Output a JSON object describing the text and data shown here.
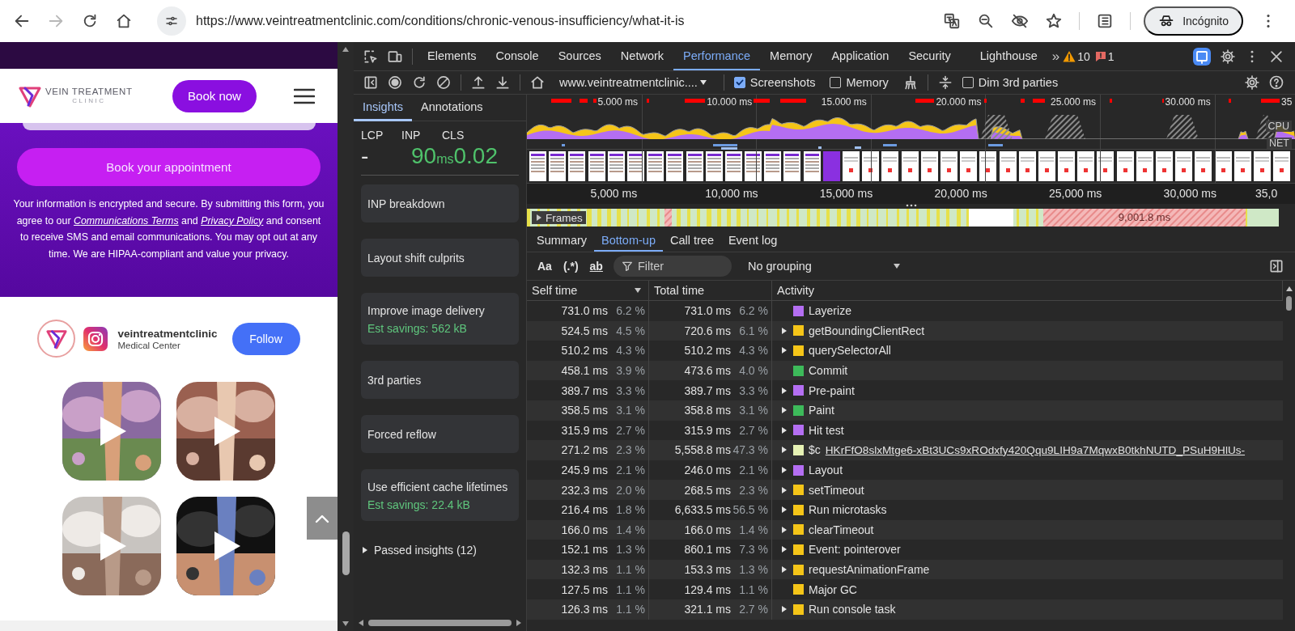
{
  "browser": {
    "url": "https://www.veintreatmentclinic.com/conditions/chronic-venous-insufficiency/what-it-is",
    "profile": "Incógnito"
  },
  "page": {
    "logo": {
      "name": "VEIN TREATMENT",
      "sub": "CLINIC"
    },
    "book_now": "Book now",
    "book_appointment": "Book your appointment",
    "consent": [
      {
        "kind": "text",
        "text": "Your information is encrypted and secure. By submitting this form, you agree to our "
      },
      {
        "kind": "link",
        "text": "Communications Terms"
      },
      {
        "kind": "text",
        "text": " and "
      },
      {
        "kind": "link",
        "text": "Privacy Policy"
      },
      {
        "kind": "text",
        "text": " and consent to receive SMS and email communications. You may opt out at any time. We are HIPAA-compliant and value your privacy."
      }
    ],
    "instagram": {
      "handle": "veintreatmentclinic",
      "category": "Medical Center",
      "follow": "Follow"
    }
  },
  "devtools": {
    "tabs": [
      {
        "label": "Elements",
        "selected": false
      },
      {
        "label": "Console",
        "selected": false
      },
      {
        "label": "Sources",
        "selected": false
      },
      {
        "label": "Network",
        "selected": false
      },
      {
        "label": "Performance",
        "selected": true
      },
      {
        "label": "Memory",
        "selected": false
      },
      {
        "label": "Application",
        "selected": false
      },
      {
        "label": "Security",
        "selected": false
      },
      {
        "label": "Lighthouse",
        "selected": false
      }
    ],
    "more_tabs": "»",
    "warnings": "10",
    "errors": "1",
    "toolbar": {
      "recording": "www.veintreatmentclinic....",
      "options": [
        {
          "label": "Screenshots",
          "checked": true
        },
        {
          "label": "Memory",
          "checked": false
        }
      ],
      "dim_third_parties": {
        "label": "Dim 3rd parties",
        "checked": false
      }
    },
    "insights": {
      "tabs": [
        {
          "label": "Insights",
          "selected": true
        },
        {
          "label": "Annotations",
          "selected": false
        }
      ],
      "metrics": [
        {
          "label": "LCP",
          "value": "-",
          "color": "#e3e3e3"
        },
        {
          "label": "INP",
          "value": "90",
          "unit": "ms",
          "color": "#4fc26b"
        },
        {
          "label": "CLS",
          "value": "0.02",
          "color": "#4fc26b"
        }
      ],
      "cards": [
        {
          "title": "INP breakdown"
        },
        {
          "title": "Layout shift culprits"
        },
        {
          "title": "Improve image delivery",
          "savings": "Est savings: 562 kB"
        },
        {
          "title": "3rd parties"
        },
        {
          "title": "Forced reflow"
        },
        {
          "title": "Use efficient cache lifetimes",
          "savings": "Est savings: 22.4 kB"
        }
      ],
      "passed": "Passed insights (12)",
      "passed_expanded": false
    },
    "timeline": {
      "overview_ticks": [
        "5.000 ms",
        "10.000 ms",
        "15.000 ms",
        "20.000 ms",
        "25.000 ms",
        "30.000 ms",
        "35"
      ],
      "cpu_label": "CPU",
      "net_label": "NET",
      "ruler_ticks": [
        "5,000 ms",
        "10,000 ms",
        "15,000 ms",
        "20,000 ms",
        "25,000 ms",
        "30,000 ms",
        "35,0"
      ],
      "frames_label": "Frames",
      "frames_expanded": false,
      "long_frame": "9,001.8 ms"
    },
    "details": {
      "tabs": [
        {
          "label": "Summary",
          "selected": false
        },
        {
          "label": "Bottom-up",
          "selected": true
        },
        {
          "label": "Call tree",
          "selected": false
        },
        {
          "label": "Event log",
          "selected": false
        }
      ],
      "filter_buttons": [
        "Aa",
        "(.*)",
        "ab"
      ],
      "filter_placeholder": "Filter",
      "grouping": "No grouping",
      "table": {
        "columns": [
          {
            "label": "Self time",
            "sorted": true
          },
          {
            "label": "Total time",
            "sorted": false
          },
          {
            "label": "Activity",
            "sorted": false
          }
        ],
        "rows": [
          {
            "self": "731.0 ms",
            "self_pct": "6.2 %",
            "total": "731.0 ms",
            "total_pct": "6.2 %",
            "activity": "Layerize",
            "color": "#b46ef2",
            "expandable": false
          },
          {
            "self": "524.5 ms",
            "self_pct": "4.5 %",
            "total": "720.6 ms",
            "total_pct": "6.1 %",
            "activity": "getBoundingClientRect",
            "color": "#f5c518",
            "expandable": true
          },
          {
            "self": "510.2 ms",
            "self_pct": "4.3 %",
            "total": "510.2 ms",
            "total_pct": "4.3 %",
            "activity": "querySelectorAll",
            "color": "#f5c518",
            "expandable": true
          },
          {
            "self": "458.1 ms",
            "self_pct": "3.9 %",
            "total": "473.6 ms",
            "total_pct": "4.0 %",
            "activity": "Commit",
            "color": "#3dba5a",
            "expandable": false
          },
          {
            "self": "389.7 ms",
            "self_pct": "3.3 %",
            "total": "389.7 ms",
            "total_pct": "3.3 %",
            "activity": "Pre-paint",
            "color": "#b46ef2",
            "expandable": true
          },
          {
            "self": "358.5 ms",
            "self_pct": "3.1 %",
            "total": "358.8 ms",
            "total_pct": "3.1 %",
            "activity": "Paint",
            "color": "#3dba5a",
            "expandable": true
          },
          {
            "self": "315.9 ms",
            "self_pct": "2.7 %",
            "total": "315.9 ms",
            "total_pct": "2.7 %",
            "activity": "Hit test",
            "color": "#b46ef2",
            "expandable": true
          },
          {
            "self": "271.2 ms",
            "self_pct": "2.3 %",
            "total": "5,558.8 ms",
            "total_pct": "47.3 %",
            "activity": "$c",
            "link": "HKrFfO8slxMtge6-xBt3UCs9xROdxfy420Qqu9LIH9a7MqwxB0tkhNUTD_PSuH9HlUs-",
            "color": "#e6f2b4",
            "expandable": true
          },
          {
            "self": "245.9 ms",
            "self_pct": "2.1 %",
            "total": "246.0 ms",
            "total_pct": "2.1 %",
            "activity": "Layout",
            "color": "#b46ef2",
            "expandable": true
          },
          {
            "self": "232.3 ms",
            "self_pct": "2.0 %",
            "total": "268.5 ms",
            "total_pct": "2.3 %",
            "activity": "setTimeout",
            "color": "#f5c518",
            "expandable": true
          },
          {
            "self": "216.4 ms",
            "self_pct": "1.8 %",
            "total": "6,633.5 ms",
            "total_pct": "56.5 %",
            "activity": "Run microtasks",
            "color": "#f5c518",
            "expandable": true
          },
          {
            "self": "166.0 ms",
            "self_pct": "1.4 %",
            "total": "166.0 ms",
            "total_pct": "1.4 %",
            "activity": "clearTimeout",
            "color": "#f5c518",
            "expandable": true
          },
          {
            "self": "152.1 ms",
            "self_pct": "1.3 %",
            "total": "860.1 ms",
            "total_pct": "7.3 %",
            "activity": "Event: pointerover",
            "color": "#f5c518",
            "expandable": true
          },
          {
            "self": "132.3 ms",
            "self_pct": "1.1 %",
            "total": "153.3 ms",
            "total_pct": "1.3 %",
            "activity": "requestAnimationFrame",
            "color": "#f5c518",
            "expandable": true
          },
          {
            "self": "127.5 ms",
            "self_pct": "1.1 %",
            "total": "129.4 ms",
            "total_pct": "1.1 %",
            "activity": "Major GC",
            "color": "#f5c518",
            "expandable": false
          },
          {
            "self": "126.3 ms",
            "self_pct": "1.1 %",
            "total": "321.1 ms",
            "total_pct": "2.7 %",
            "activity": "Run console task",
            "color": "#f5c518",
            "expandable": true
          }
        ]
      }
    }
  }
}
